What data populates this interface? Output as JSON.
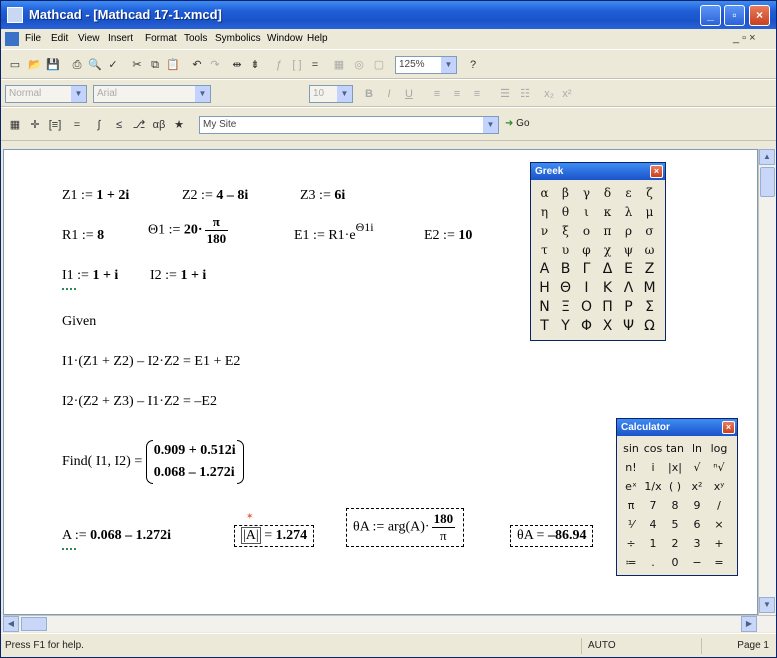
{
  "window": {
    "title": "Mathcad - [Mathcad 17-1.xmcd]"
  },
  "menu": {
    "items": [
      "File",
      "Edit",
      "View",
      "Insert",
      "Format",
      "Tools",
      "Symbolics",
      "Window",
      "Help"
    ],
    "mdi_controls": "_ ▫ ×"
  },
  "toolbar": {
    "zoom": "125%",
    "style": "Normal",
    "font": "Arial",
    "font_size": "10",
    "site": "My Site",
    "go_label": "Go"
  },
  "worksheet": {
    "line1": {
      "z1": "Z1 :=",
      "z1v": "1 + 2i",
      "z2": "Z2 :=",
      "z2v": "4 – 8i",
      "z3": "Z3 :=",
      "z3v": "6i"
    },
    "line2": {
      "r1": "R1 :=",
      "r1v": "8",
      "th": "Θ1 :=",
      "thv": "20·",
      "thn": "π",
      "thd": "180",
      "e1": "E1 := R1·e",
      "e1sup": "Θ1i",
      "e2": "E2 :=",
      "e2v": "10"
    },
    "line3": {
      "i1": "I1 :=",
      "i1v": "1 + i",
      "i2": "I2 :=",
      "i2v": "1 + i"
    },
    "given": "Given",
    "eq1": "I1·(Z1 + Z2) – I2·Z2 = E1 + E2",
    "eq2": "I2·(Z2 + Z3) – I1·Z2 = –E2",
    "find": {
      "label": "Find( I1, I2) =",
      "r1": "0.909 + 0.512i",
      "r2": "0.068 – 1.272i"
    },
    "bottom": {
      "a": "A :=",
      "av": "0.068 – 1.272i",
      "absA": "|A|",
      "absAeq": "=",
      "absAv": "1.274",
      "ta": "θA := arg(A)·",
      "tan": "180",
      "tad": "π",
      "tres": "θA =",
      "tresv": "–86.94"
    }
  },
  "greek_palette": {
    "title": "Greek",
    "lower": [
      "α",
      "β",
      "γ",
      "δ",
      "ε",
      "ζ",
      "η",
      "θ",
      "ι",
      "κ",
      "λ",
      "μ",
      "ν",
      "ξ",
      "ο",
      "π",
      "ρ",
      "σ",
      "τ",
      "υ",
      "φ",
      "χ",
      "ψ",
      "ω"
    ],
    "upper": [
      "Α",
      "Β",
      "Γ",
      "Δ",
      "Ε",
      "Ζ",
      "Η",
      "Θ",
      "Ι",
      "Κ",
      "Λ",
      "Μ",
      "Ν",
      "Ξ",
      "Ο",
      "Π",
      "Ρ",
      "Σ",
      "Τ",
      "Υ",
      "Φ",
      "Χ",
      "Ψ",
      "Ω"
    ]
  },
  "calculator_palette": {
    "title": "Calculator",
    "keys": [
      "sin",
      "cos",
      "tan",
      "ln",
      "log",
      "n!",
      "i",
      "|x|",
      "√",
      "ⁿ√",
      "eˣ",
      "1/x",
      "( )",
      "x²",
      "xʸ",
      "π",
      "7",
      "8",
      "9",
      "/",
      "⅟",
      "4",
      "5",
      "6",
      "×",
      "÷",
      "1",
      "2",
      "3",
      "+",
      "≔",
      ".",
      "0",
      "−",
      "="
    ]
  },
  "status": {
    "help": "Press F1 for help.",
    "mode": "AUTO",
    "page": "Page 1"
  }
}
